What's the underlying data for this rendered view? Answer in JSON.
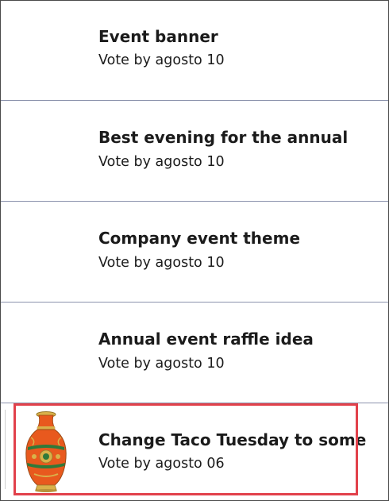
{
  "gallery": {
    "items": [
      {
        "title": "Event banner",
        "subtitle": "Vote by agosto 10",
        "has_image": false
      },
      {
        "title": "Best evening for the annual",
        "subtitle": "Vote by agosto 10",
        "has_image": false
      },
      {
        "title": "Company event theme",
        "subtitle": "Vote by agosto 10",
        "has_image": false
      },
      {
        "title": "Annual event raffle idea",
        "subtitle": "Vote by agosto 10",
        "has_image": false
      },
      {
        "title": "Change Taco Tuesday to some",
        "subtitle": "Vote by agosto 06",
        "has_image": true,
        "image": "vase-image"
      }
    ],
    "selected_index": 4
  },
  "colors": {
    "divider": "#8c93ad",
    "selection_border": "#e2414b",
    "vase_orange": "#e8591e",
    "vase_gold": "#d9b14a",
    "vase_green": "#2f7a3a"
  }
}
